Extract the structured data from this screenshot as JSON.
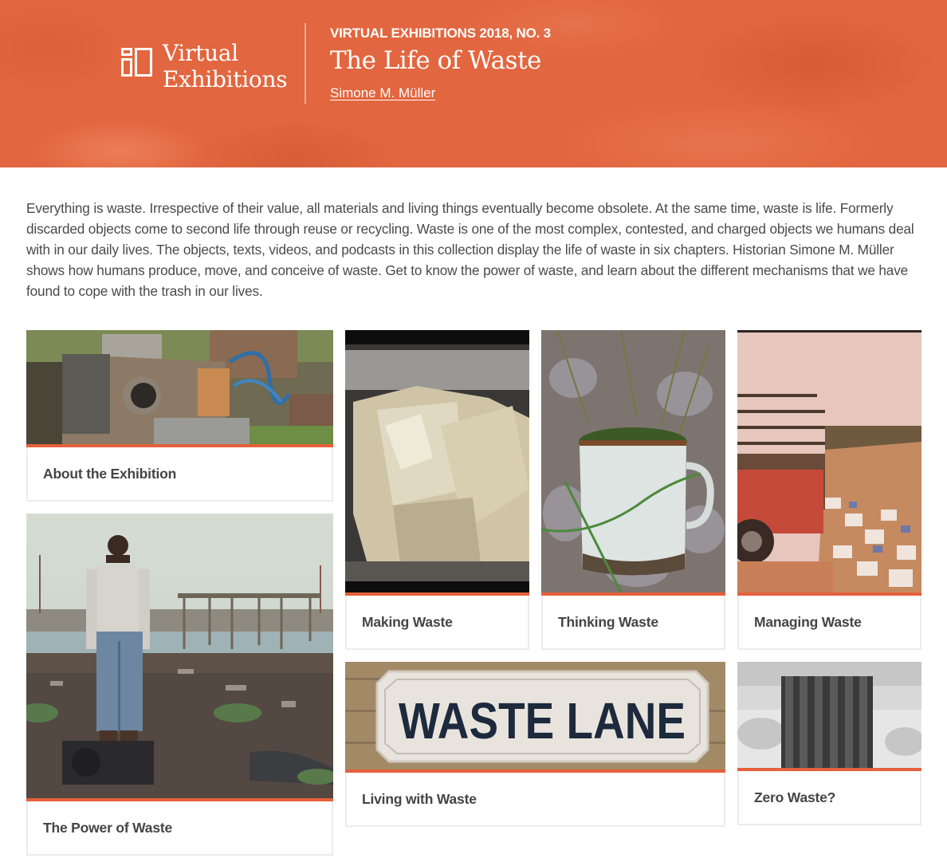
{
  "header": {
    "logo": {
      "icon": "virtual-exhibitions-logo-icon",
      "line1": "Virtual",
      "line2": "Exhibitions"
    },
    "series": "VIRTUAL EXHIBITIONS 2018, NO. 3",
    "title": "The Life of Waste",
    "author": "Simone M. Müller",
    "background_color": "#e2663f"
  },
  "intro": {
    "text": "Everything is waste. Irrespective of their value, all materials and living things eventually become obsolete. At the same time, waste is life. Formerly discarded objects come to second life through reuse or recycling. Waste is one of the most complex, contested, and charged objects we humans deal with in our daily lives. The objects, texts, videos, and podcasts in this collection display the life of waste in six chapters. Historian Simone M. Müller shows how humans produce, move, and conceive of waste. Get to know the power of waste, and learn about the different mechanisms that we have found to cope with the trash in our lives."
  },
  "accent_color": "#e5603c",
  "cards": [
    {
      "label": "About the Exhibition",
      "image": "discarded appliances and junk pile"
    },
    {
      "label": "Making Waste",
      "image": "crumpled paper in plastic bag"
    },
    {
      "label": "Thinking Waste",
      "image": "enamel mug with moss on rocks"
    },
    {
      "label": "Managing Waste",
      "image": "red truck at landfill"
    },
    {
      "label": "The Power of Waste",
      "image": "man standing on e-waste dump"
    },
    {
      "label": "Living with Waste",
      "image": "WASTE LANE street sign",
      "sign_text": "WASTE LANE"
    },
    {
      "label": "Zero Waste?",
      "image": "wooden slatted trash bin"
    }
  ]
}
